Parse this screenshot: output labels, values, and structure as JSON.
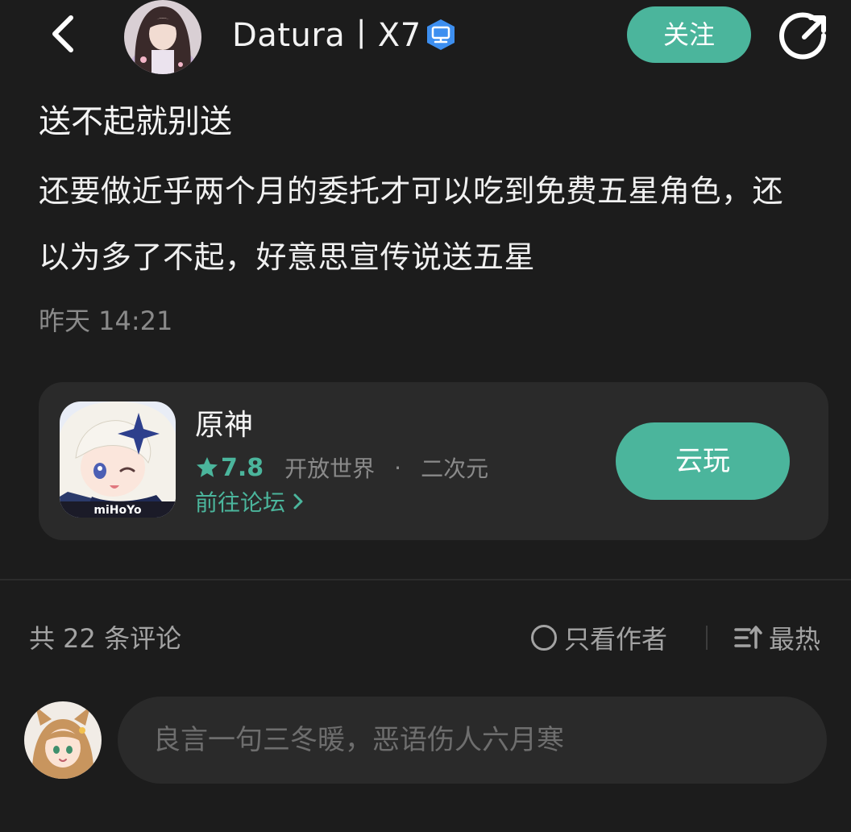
{
  "colors": {
    "background": "#1c1c1c",
    "card": "#2a2a2a",
    "accent": "#4bb59c",
    "muted_text": "#8a8a8a"
  },
  "header": {
    "back_icon": "chevron-left-icon",
    "username": "Datura丨X7",
    "verified_icon": "computer-badge-icon",
    "follow_label": "关注",
    "share_icon": "share-arrow-icon"
  },
  "post": {
    "title": "送不起就别送",
    "body": "还要做近乎两个月的委托才可以吃到免费五星角色，还以为多了不起，好意思宣传说送五星",
    "time": "昨天 14:21"
  },
  "game_card": {
    "name": "原神",
    "rating": "7.8",
    "tags": [
      "开放世界",
      "二次元"
    ],
    "tag_separator": "·",
    "forum_link": "前往论坛",
    "play_label": "云玩",
    "icon_caption": "miHoYo"
  },
  "comments": {
    "count_label": "共 22 条评论",
    "author_only_label": "只看作者",
    "sort_label": "最热",
    "input_placeholder": "良言一句三冬暖，恶语伤人六月寒"
  }
}
